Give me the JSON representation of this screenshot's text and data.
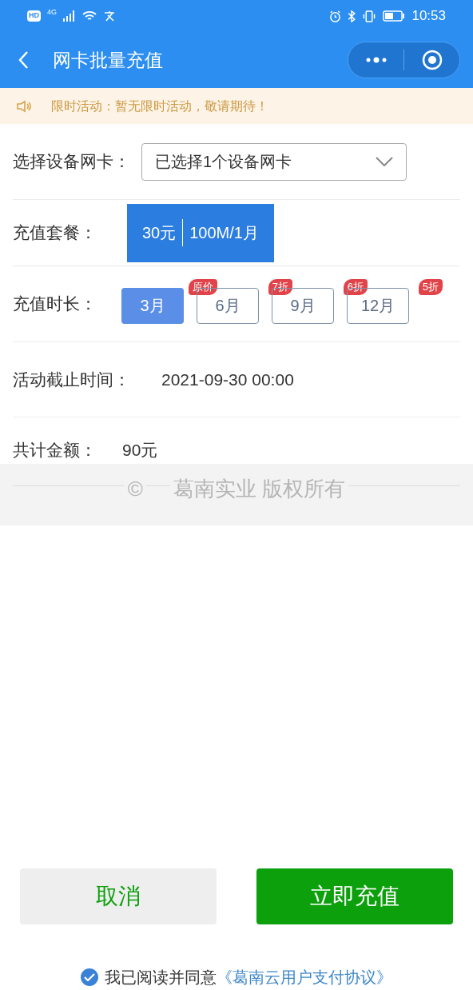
{
  "status_bar": {
    "time": "10:53",
    "hd": "HD",
    "network": "4G"
  },
  "header": {
    "title": "网卡批量充值"
  },
  "notice": {
    "text": "限时活动：暂无限时活动，敬请期待！"
  },
  "device": {
    "label": "选择设备网卡：",
    "value": "已选择1个设备网卡"
  },
  "package": {
    "label": "充值套餐：",
    "options": [
      {
        "price": "30元",
        "spec": "100M/1月",
        "selected": true
      }
    ]
  },
  "duration": {
    "label": "充值时长：",
    "options": [
      {
        "text": "3月",
        "badge": "原价",
        "selected": true
      },
      {
        "text": "6月",
        "badge": "7折",
        "selected": false
      },
      {
        "text": "9月",
        "badge": "6折",
        "selected": false
      },
      {
        "text": "12月",
        "badge": "5折",
        "selected": false
      }
    ]
  },
  "deadline": {
    "label": "活动截止时间：",
    "value": "2021-09-30 00:00"
  },
  "total": {
    "label": "共计金额：",
    "value": "90元"
  },
  "footer": {
    "symbol": "©",
    "text": "葛南实业 版权所有"
  },
  "buttons": [
    {
      "kind": "cancel",
      "label": "取消"
    },
    {
      "kind": "primary",
      "label": "立即充值"
    }
  ],
  "agreement": {
    "checked": true,
    "text": "我已阅读并同意",
    "link": "《葛南云用户支付协议》"
  }
}
